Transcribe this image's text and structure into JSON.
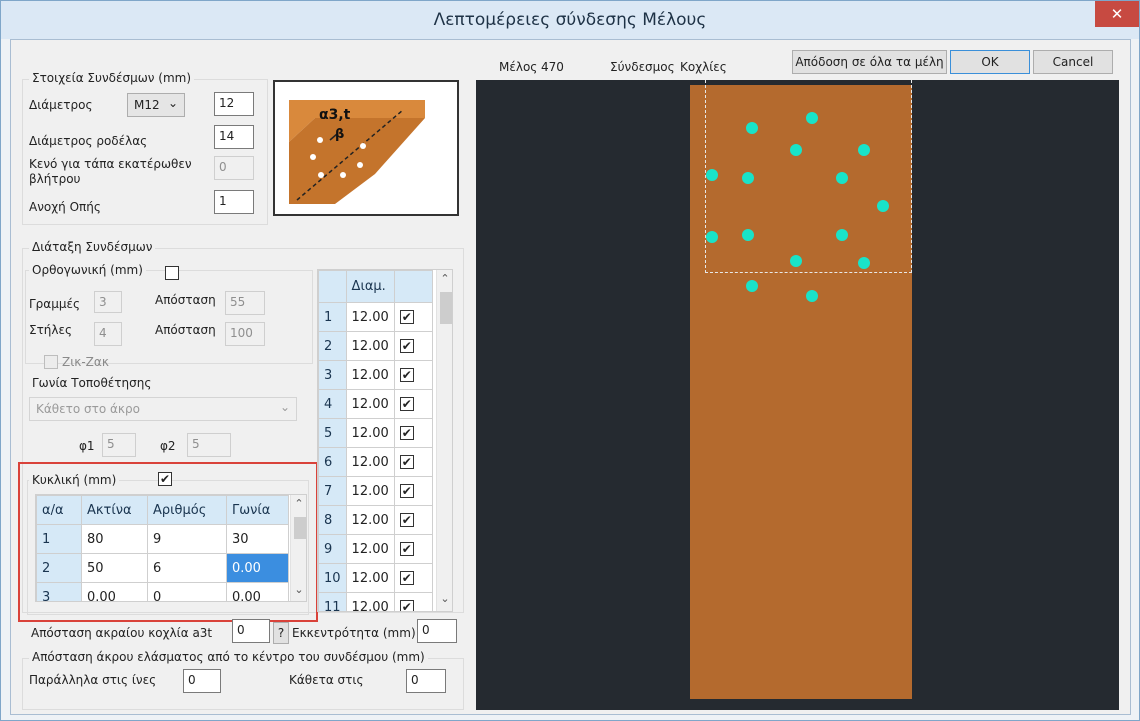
{
  "window": {
    "title": "Λεπτομέρειες σύνδεσης Μέλους",
    "close_label": "✕"
  },
  "top": {
    "member_label": "Μέλος",
    "member_value": "470",
    "connector_label": "Σύνδεσμος",
    "connector_value": "Κοχλίες",
    "apply_all_label": "Απόδοση σε όλα τα μέλη",
    "ok_label": "OK",
    "cancel_label": "Cancel"
  },
  "fasteners": {
    "group_title": "Στοιχεία Συνδέσμων (mm)",
    "diameter_label": "Διάμετρος",
    "diameter_select": "M12",
    "diameter_value": "12",
    "washer_label": "Διάμετρος ροδέλας",
    "washer_value": "14",
    "gap_label_1": "Κενό για τάπα εκατέρωθεν",
    "gap_label_2": "βλήτρου",
    "gap_value": "0",
    "tolerance_label": "Ανοχή Οπής",
    "tolerance_value": "1",
    "diagram_label_a": "α3,t",
    "diagram_label_b": "β"
  },
  "arrangement": {
    "group_title": "Διάταξη Συνδέσμων",
    "orthogonal": {
      "title": "Ορθογωνική (mm)",
      "checked": false,
      "rows_label": "Γραμμές",
      "rows_value": "3",
      "spacing1_label": "Απόσταση",
      "spacing1_value": "55",
      "cols_label": "Στήλες",
      "cols_value": "4",
      "spacing2_label": "Απόσταση",
      "spacing2_value": "100",
      "zigzag_label": "Ζικ-Ζακ"
    },
    "angle": {
      "title": "Γωνία Τοποθέτησης",
      "select": "Κάθετο στο άκρο",
      "phi1_label": "φ1",
      "phi1_value": "5",
      "phi2_label": "φ2",
      "phi2_value": "5"
    },
    "circular": {
      "title": "Κυκλική (mm)",
      "checked": true,
      "headers": [
        "α/α",
        "Ακτίνα",
        "Αριθμός",
        "Γωνία"
      ],
      "rows": [
        [
          "1",
          "80",
          "9",
          "30"
        ],
        [
          "2",
          "50",
          "6",
          "0.00"
        ],
        [
          "3",
          "0.00",
          "0",
          "0.00"
        ]
      ],
      "selected_cell": "0.00"
    }
  },
  "diam_table": {
    "header": "Διαμ.",
    "rows": [
      [
        "1",
        "12.00"
      ],
      [
        "2",
        "12.00"
      ],
      [
        "3",
        "12.00"
      ],
      [
        "4",
        "12.00"
      ],
      [
        "5",
        "12.00"
      ],
      [
        "6",
        "12.00"
      ],
      [
        "7",
        "12.00"
      ],
      [
        "8",
        "12.00"
      ],
      [
        "9",
        "12.00"
      ],
      [
        "10",
        "12.00"
      ],
      [
        "11",
        "12.00"
      ]
    ],
    "check": "✔"
  },
  "bottom": {
    "a3t_label": "Απόσταση ακραίου κοχλία a3t",
    "a3t_value": "0",
    "help_label": "?",
    "eccentricity_label": "Εκκεντρότητα (mm)",
    "eccentricity_value": "0",
    "edge_group_title": "Απόσταση άκρου ελάσματος από το κέντρο του συνδέσμου (mm)",
    "parallel_label": "Παράλληλα στις ίνες",
    "parallel_value": "0",
    "perpendicular_label": "Κάθετα στις",
    "perpendicular_value": "0"
  },
  "view": {
    "colors": {
      "canvas": "#252a30",
      "timber": "#b46a2e",
      "bolt": "#19e3c8",
      "frame": "#e8e8e8"
    },
    "bolt_count": 15
  }
}
